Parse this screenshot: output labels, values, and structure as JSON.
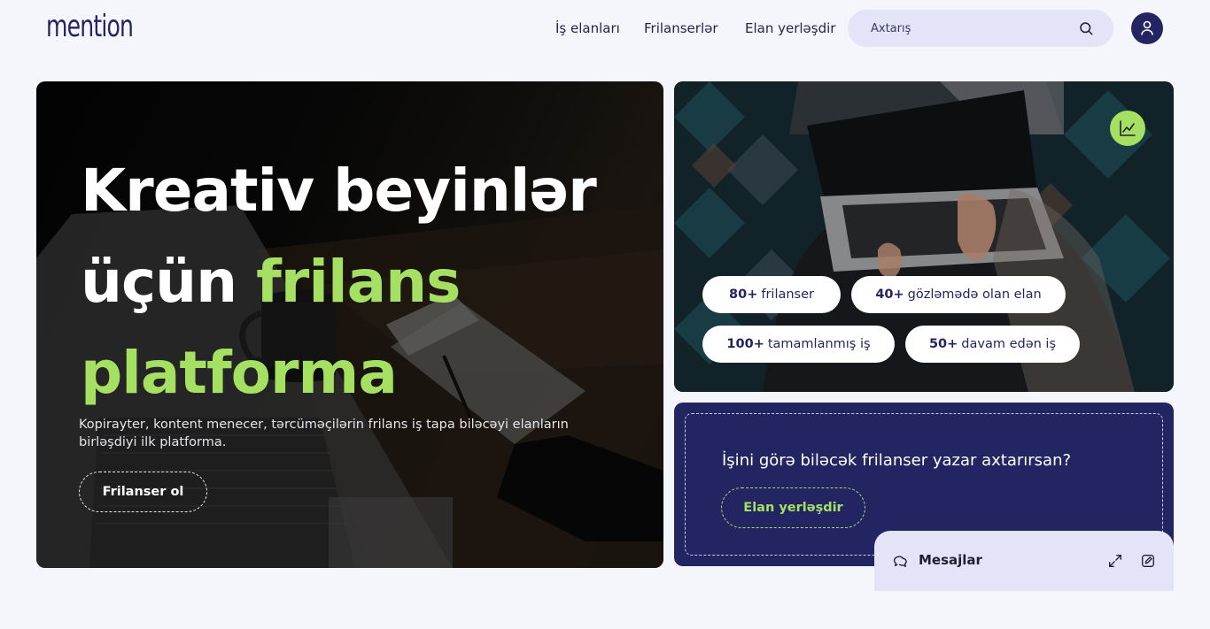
{
  "header": {
    "logo": "mention",
    "nav": [
      "İş elanları",
      "Frilanserlər",
      "Elan yerləşdir"
    ],
    "search_placeholder": "Axtarış"
  },
  "hero": {
    "title_line1": "Kreativ beyinlər",
    "title_line2_plain": "üçün ",
    "title_line2_accent": "frilans",
    "title_line3_accent": "platforma",
    "description": "Kopirayter, kontent menecer, tərcüməçilərin frilans iş tapa biləcəyi elanların birləşdiyi ilk platforma.",
    "button_label": "Frilanser ol"
  },
  "stats": [
    {
      "value": "80+",
      "label": "frilanser"
    },
    {
      "value": "40+",
      "label": "gözləmədə olan elan"
    },
    {
      "value": "100+",
      "label": "tamamlanmış iş"
    },
    {
      "value": "50+",
      "label": "davam edən iş"
    }
  ],
  "cta": {
    "text": "İşini görə biləcək frilanser yazar axtarırsan?",
    "button_label": "Elan yerləşdir"
  },
  "messages": {
    "title": "Mesajlar"
  },
  "colors": {
    "accent": "#a6e063",
    "primary": "#232563",
    "background": "#f5f5fc",
    "panel": "#e3e4f7"
  }
}
